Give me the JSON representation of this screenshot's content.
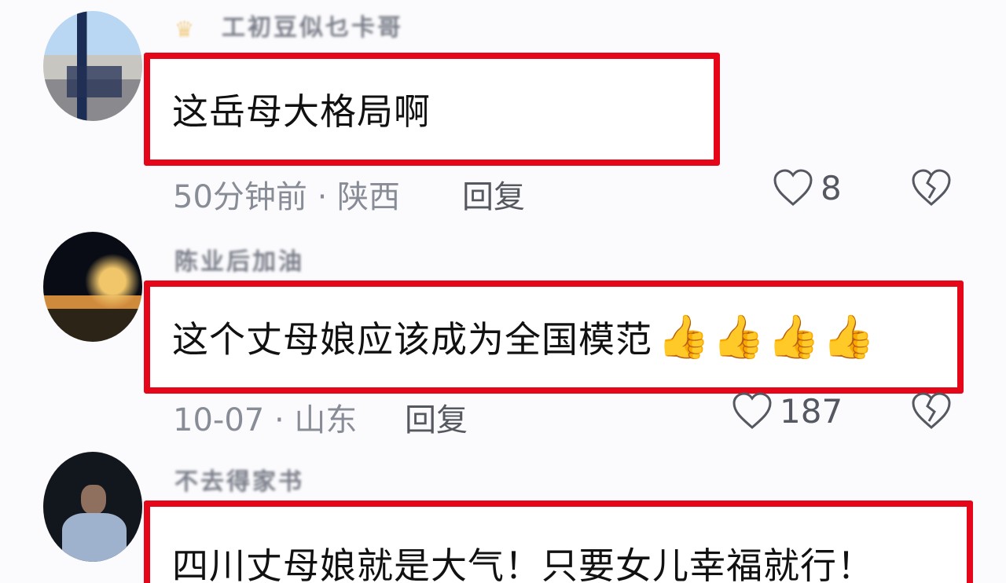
{
  "comments": [
    {
      "username": "工初豆似乜卡哥",
      "text": "这岳母大格局啊",
      "time_location": "50分钟前 · 陕西",
      "reply_label": "回复",
      "likes": "8",
      "thumbs_count": 0
    },
    {
      "username": "陈业后加油",
      "text": "这个丈母娘应该成为全国模范",
      "time_location": "10-07 · 山东",
      "reply_label": "回复",
      "likes": "187",
      "thumbs_count": 4
    },
    {
      "username": "不去得家书",
      "text": "四川丈母娘就是大气！只要女儿幸福就行！",
      "time_location": "",
      "reply_label": "",
      "likes": "",
      "thumbs_count": 0
    }
  ],
  "colors": {
    "highlight_border": "#e6061a",
    "muted_text": "#888c96",
    "primary_text": "#111111"
  }
}
